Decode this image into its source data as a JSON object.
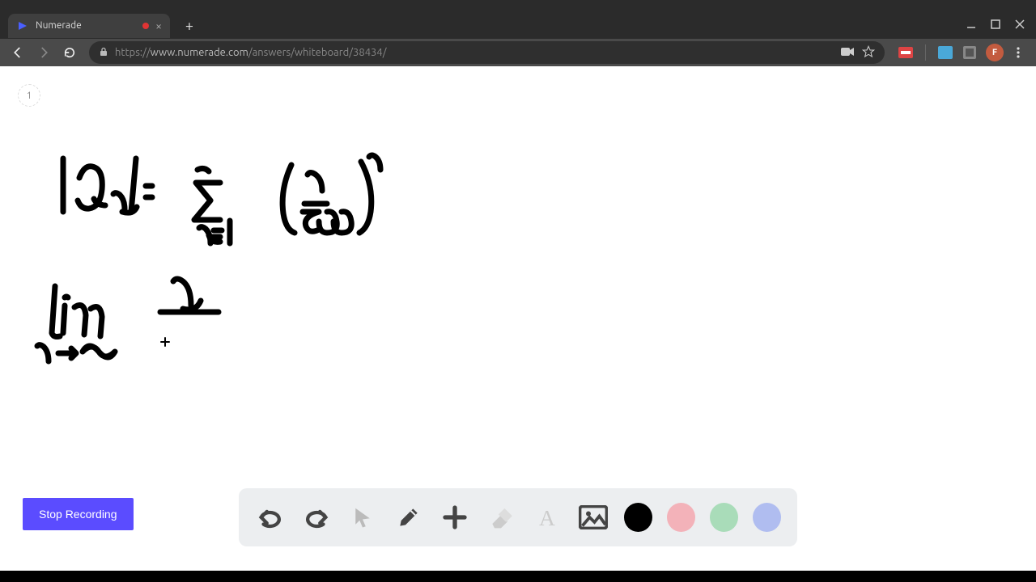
{
  "tab": {
    "title": "Numerade"
  },
  "address": {
    "scheme": "https://",
    "host": "www.numerade.com",
    "path": "/answers/whiteboard/38434/"
  },
  "avatar_initial": "F",
  "page_number": "1",
  "stop_button_label": "Stop Recording",
  "toolbar_icons": {
    "undo": "undo",
    "redo": "redo",
    "pointer": "pointer",
    "pencil": "pencil",
    "plus": "plus",
    "eraser": "eraser",
    "text": "text",
    "image": "image"
  },
  "colors": {
    "black": "#000000",
    "pink": "#f3b2b9",
    "green": "#a9dcb9",
    "blue": "#b0bdf0"
  },
  "whiteboard_content": "|a_n| = Σ_{n=1}^{∞} (n/500)^n ; lim_{n→∞} n / ..."
}
